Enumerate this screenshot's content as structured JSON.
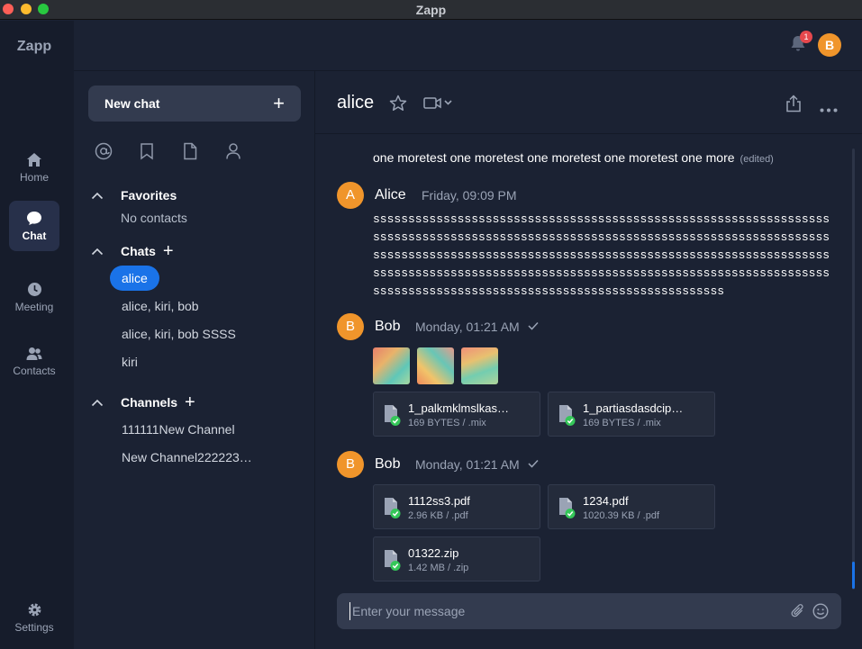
{
  "window": {
    "title": "Zapp"
  },
  "rail": {
    "brand": "Zapp",
    "items": [
      {
        "label": "Home",
        "icon": "home-icon"
      },
      {
        "label": "Chat",
        "icon": "chat-icon"
      },
      {
        "label": "Meeting",
        "icon": "clock-icon"
      },
      {
        "label": "Contacts",
        "icon": "contacts-icon"
      }
    ],
    "settings_label": "Settings"
  },
  "topbar": {
    "notification_count": "1",
    "user_initial": "B"
  },
  "sidebar": {
    "new_chat_label": "New chat",
    "favorites": {
      "title": "Favorites",
      "empty": "No contacts"
    },
    "chats": {
      "title": "Chats",
      "items": [
        "alice",
        "alice, kiri, bob",
        "alice, kiri, bob SSSS",
        "kiri"
      ]
    },
    "channels": {
      "title": "Channels",
      "items": [
        "111111New Channel",
        "New Channel222223…"
      ]
    }
  },
  "chat": {
    "title": "alice",
    "messages": {
      "first_text": "one moretest one moretest one moretest one moretest one more",
      "edited_label": "(edited)",
      "alice": {
        "initial": "A",
        "sender": "Alice",
        "time": "Friday, 09:09 PM",
        "text": "ssssssssssssssssssssssssssssssssssssssssssssssssssssssssssssssssssssssssssssssssssssssssssssssssssssssssssssssssssssssssssssssssssssssssssssssssssssssssssssssssssssssssssssssssssssssssssssssssssssssssssssssssssssssssssssssssssssssssssssssssssssssssssssssssssssssssssssssssssssssssssssssssssssssssssssssssssssss"
      },
      "bob1": {
        "initial": "B",
        "sender": "Bob",
        "time": "Monday, 01:21 AM",
        "files": [
          {
            "name": "1_palkmklmslkas…",
            "meta": "169 BYTES / .mix"
          },
          {
            "name": "1_partiasdasdcip…",
            "meta": "169 BYTES / .mix"
          }
        ]
      },
      "bob2": {
        "initial": "B",
        "sender": "Bob",
        "time": "Monday, 01:21 AM",
        "files": [
          {
            "name": "1112ss3.pdf",
            "meta": "2.96 KB / .pdf"
          },
          {
            "name": "1234.pdf",
            "meta": "1020.39 KB / .pdf"
          },
          {
            "name": "01322.zip",
            "meta": "1.42 MB / .zip"
          }
        ]
      }
    },
    "composer": {
      "placeholder": "Enter your message",
      "value": ""
    }
  },
  "colors": {
    "accent": "#1a73e8",
    "avatar": "#f0952b",
    "badge": "#e5484d",
    "file_ok": "#35c759"
  }
}
